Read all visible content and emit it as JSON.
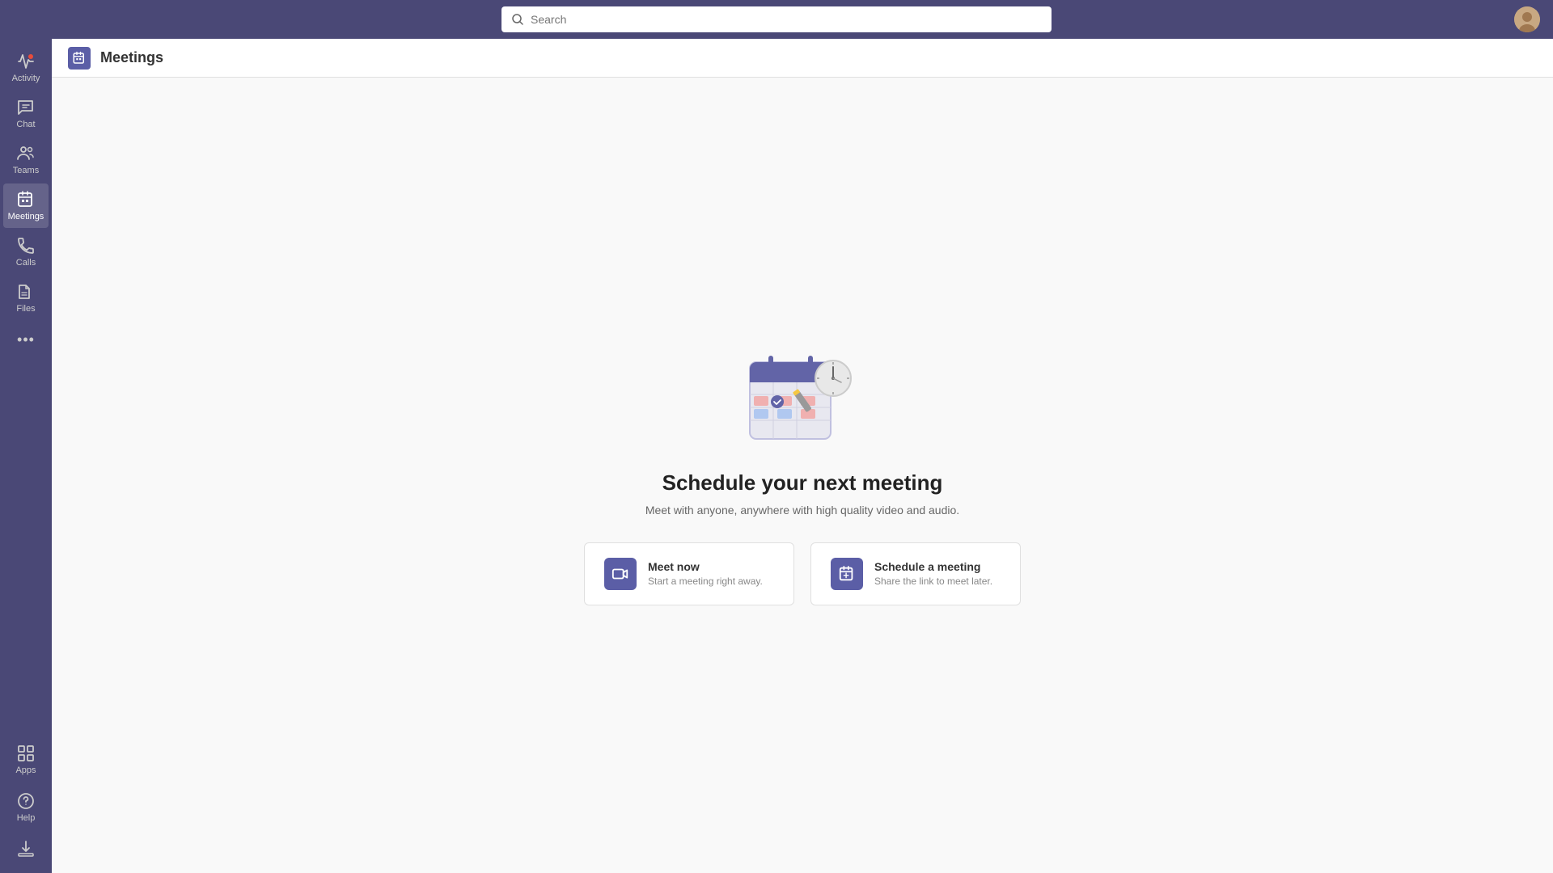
{
  "topbar": {
    "search_placeholder": "Search"
  },
  "sidebar": {
    "items": [
      {
        "id": "activity",
        "label": "Activity",
        "active": false
      },
      {
        "id": "chat",
        "label": "Chat",
        "active": false
      },
      {
        "id": "teams",
        "label": "Teams",
        "active": false
      },
      {
        "id": "meetings",
        "label": "Meetings",
        "active": true
      },
      {
        "id": "calls",
        "label": "Calls",
        "active": false
      },
      {
        "id": "files",
        "label": "Files",
        "active": false
      }
    ],
    "more_label": "...",
    "apps_label": "Apps",
    "help_label": "Help"
  },
  "header": {
    "title": "Meetings"
  },
  "main": {
    "heading": "Schedule your next meeting",
    "subheading": "Meet with anyone, anywhere with high quality video and audio.",
    "cards": [
      {
        "id": "meet-now",
        "title": "Meet now",
        "subtitle": "Start a meeting right away."
      },
      {
        "id": "schedule-meeting",
        "title": "Schedule a meeting",
        "subtitle": "Share the link to meet later."
      }
    ]
  },
  "colors": {
    "sidebar_bg": "#4a4876",
    "accent": "#5b5ea6"
  }
}
